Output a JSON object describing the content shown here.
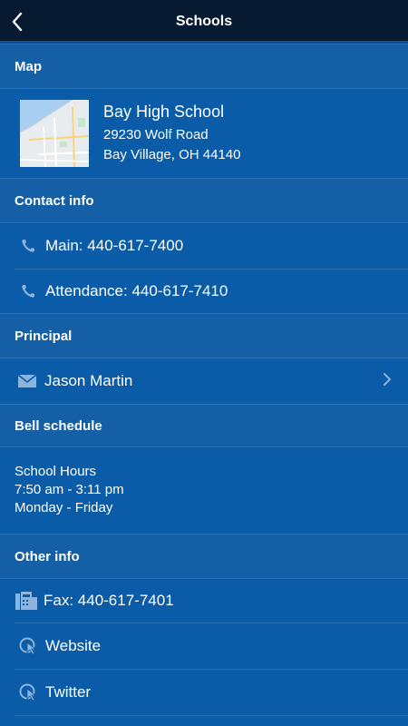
{
  "header": {
    "title": "Schools"
  },
  "sections": {
    "map": "Map",
    "contact": "Contact info",
    "principal": "Principal",
    "bell": "Bell schedule",
    "other": "Other info"
  },
  "school": {
    "name": "Bay High School",
    "street": "29230 Wolf Road",
    "city": "Bay Village, OH 44140"
  },
  "contact": {
    "main": "Main: 440-617-7400",
    "attendance": "Attendance: 440-617-7410"
  },
  "principal": {
    "name": "Jason Martin"
  },
  "bell": {
    "line1": "School Hours",
    "line2": "7:50 am - 3:11 pm",
    "line3": "Monday - Friday"
  },
  "other": {
    "fax": "Fax: 440-617-7401",
    "website": "Website",
    "twitter": "Twitter"
  },
  "icons": {
    "back": "chevron-left-icon",
    "phone": "phone-icon",
    "mail": "envelope-icon",
    "fax": "fax-icon",
    "link": "link-icon",
    "chevron": "chevron-right-icon"
  },
  "colors": {
    "background": "#0a5ba8",
    "topbar": "#071a31",
    "section": "#155fa7"
  }
}
